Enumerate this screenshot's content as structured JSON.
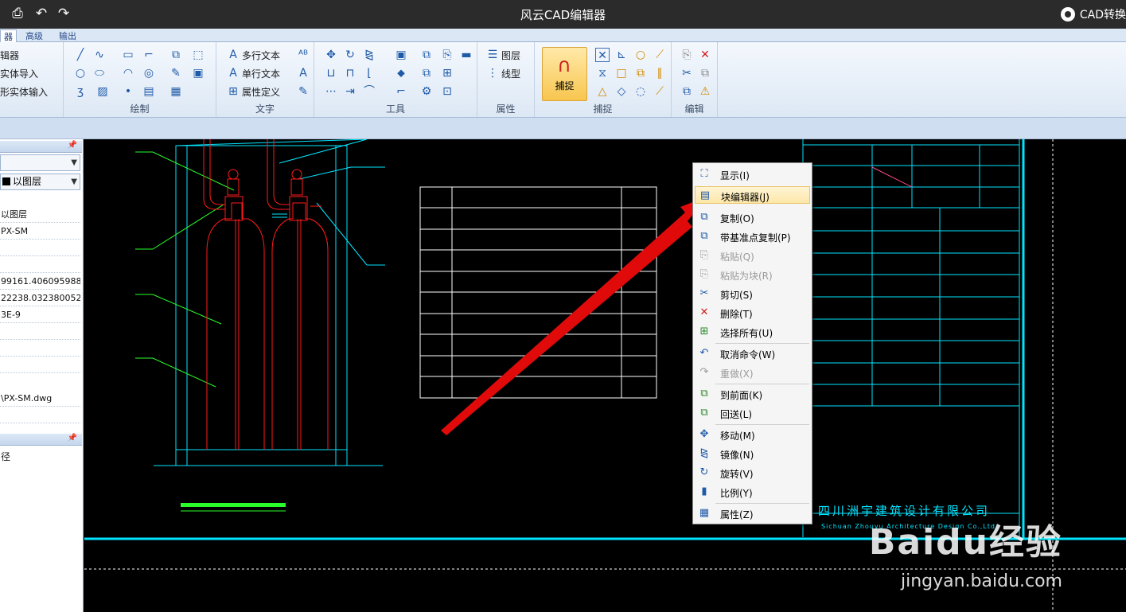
{
  "window": {
    "title": "风云CAD编辑器",
    "brand": "CAD转换"
  },
  "tabs": [
    {
      "label": "器"
    },
    {
      "label": "高级"
    },
    {
      "label": "输出"
    }
  ],
  "ribbon": {
    "editor_items": [
      "辑器",
      "实体导入",
      "形实体输入"
    ],
    "draw_label": "绘制",
    "text_group": {
      "label": "文字",
      "items": [
        "多行文本",
        "单行文本",
        "属性定义"
      ]
    },
    "tools_label": "工具",
    "props_group": {
      "label": "属性",
      "items": [
        "图层",
        "线型"
      ]
    },
    "snap_group": {
      "label": "捕捉",
      "button": "捕捉"
    },
    "edit_label": "编辑"
  },
  "left_panel": {
    "color_combo": "以图层",
    "properties": [
      "以图层",
      "PX-SM",
      "",
      "",
      "99161.406095988",
      "22238.032380052",
      "3E-9",
      "",
      "",
      "",
      "\\PX-SM.dwg",
      ""
    ],
    "lower_item": "径"
  },
  "context_menu": {
    "items": [
      {
        "label": "显示(I)",
        "icon": "zoom-extents-icon"
      },
      {
        "label": "块编辑器(J)",
        "icon": "block-editor-icon"
      },
      {
        "label": "复制(O)",
        "icon": "copy-icon"
      },
      {
        "label": "带基准点复制(P)",
        "icon": "copy-base-icon"
      },
      {
        "label": "粘贴(Q)",
        "icon": "paste-icon"
      },
      {
        "label": "粘贴为块(R)",
        "icon": "paste-block-icon"
      },
      {
        "label": "剪切(S)",
        "icon": "cut-icon"
      },
      {
        "label": "删除(T)",
        "icon": "delete-icon"
      },
      {
        "label": "选择所有(U)",
        "icon": "select-all-icon"
      },
      {
        "label": "取消命令(W)",
        "icon": "undo-icon"
      },
      {
        "label": "重做(X)",
        "icon": "redo-icon"
      },
      {
        "label": "到前面(K)",
        "icon": "bring-front-icon"
      },
      {
        "label": "回送(L)",
        "icon": "send-back-icon"
      },
      {
        "label": "移动(M)",
        "icon": "move-icon"
      },
      {
        "label": "镜像(N)",
        "icon": "mirror-icon"
      },
      {
        "label": "旋转(V)",
        "icon": "rotate-icon"
      },
      {
        "label": "比例(Y)",
        "icon": "scale-icon"
      },
      {
        "label": "属性(Z)",
        "icon": "properties-icon"
      }
    ]
  },
  "drawing": {
    "company_cn": "四川洲宇建筑设计有限公司",
    "company_en": "Sichuan Zhouyu Architecture Design Co.,Ltd"
  },
  "watermark": {
    "main": "Baidu经验",
    "url": "jingyan.baidu.com"
  },
  "colors": {
    "cyan": "#00e5ff",
    "red": "#ff1a1a",
    "green": "#2aff2a",
    "highlight": "#fde7a8"
  }
}
